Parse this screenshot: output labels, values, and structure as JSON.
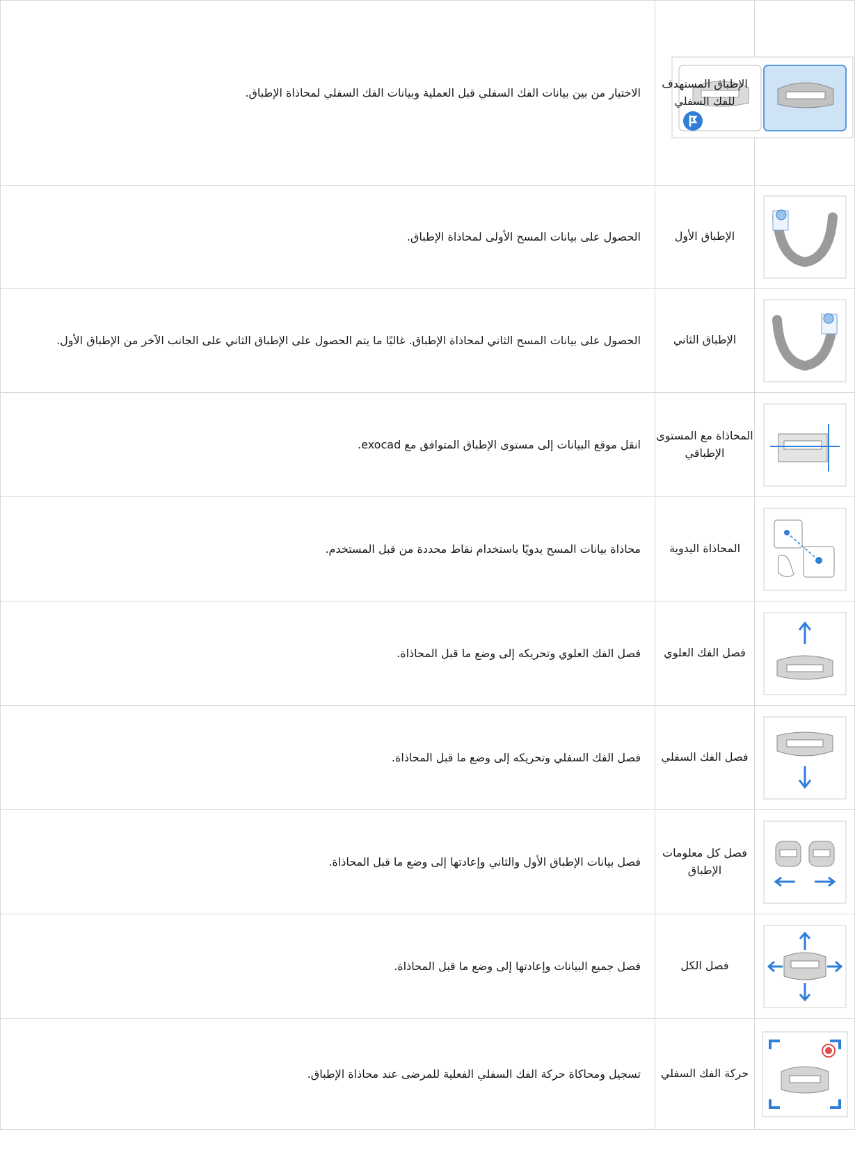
{
  "rows": [
    {
      "name": "الإطباق المستهدف للفك السفلي",
      "icon": "target-lower-jaw-bite-icon",
      "description": "الاختيار من بين بيانات الفك السفلي قبل العملية وبيانات الفك السفلي لمحاذاة الإطباق."
    },
    {
      "name": "الإطباق الأول",
      "icon": "first-bite-icon",
      "description": "الحصول على بيانات المسح الأولى لمحاذاة الإطباق."
    },
    {
      "name": "الإطباق الثاني",
      "icon": "second-bite-icon",
      "description": "الحصول على بيانات المسح الثاني لمحاذاة الإطباق. غالبًا ما يتم الحصول على الإطباق الثاني على الجانب الآخر من الإطباق الأول."
    },
    {
      "name": "المحاذاة مع المستوى الإطباقي",
      "icon": "occlusal-plane-alignment-icon",
      "description": "انقل موقع البيانات إلى مستوى الإطباق المتوافق مع exocad."
    },
    {
      "name": "المحاذاة اليدوية",
      "icon": "manual-alignment-icon",
      "description": "محاذاة بيانات المسح يدويًا باستخدام نقاط محددة من قبل المستخدم."
    },
    {
      "name": "فصل الفك العلوي",
      "icon": "separate-upper-jaw-icon",
      "description": "فصل الفك العلوي وتحريكه إلى وضع ما قبل المحاذاة."
    },
    {
      "name": "فصل الفك السفلي",
      "icon": "separate-lower-jaw-icon",
      "description": "فصل الفك السفلي وتحريكه إلى وضع ما قبل المحاذاة."
    },
    {
      "name": "فصل كل معلومات الإطباق",
      "icon": "separate-all-bite-info-icon",
      "description": "فصل بيانات الإطباق الأول والثاني وإعادتها إلى وضع ما قبل المحاذاة."
    },
    {
      "name": "فصل الكل",
      "icon": "separate-all-icon",
      "description": "فصل جميع البيانات وإعادتها إلى وضع ما قبل المحاذاة."
    },
    {
      "name": "حركة الفك السفلي",
      "icon": "lower-jaw-motion-icon",
      "description": "تسجيل ومحاكاة حركة الفك السفلي الفعلية للمرضى عند محاذاة الإطباق."
    }
  ],
  "colors": {
    "border": "#d8d8d8",
    "accent": "#2f7ed8",
    "gray": "#9a9a9a",
    "highlight": "#cfe3f7"
  }
}
